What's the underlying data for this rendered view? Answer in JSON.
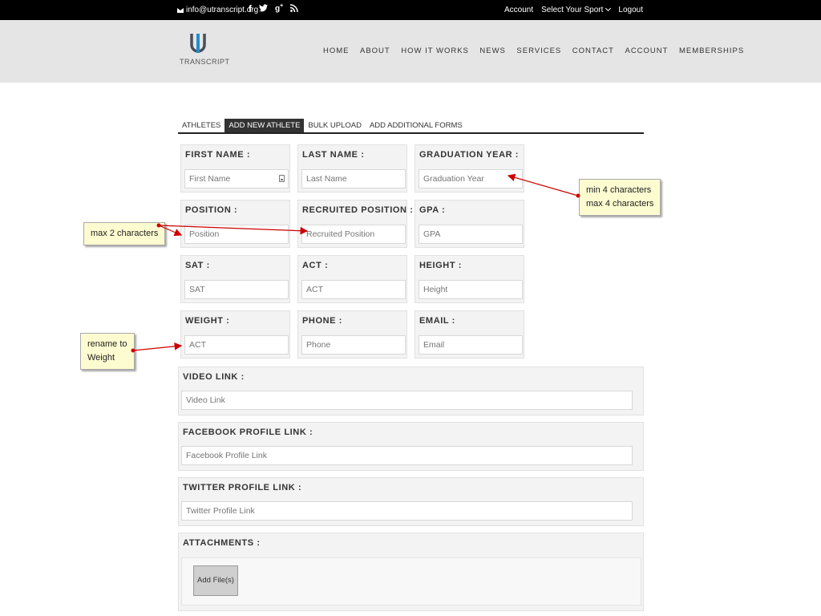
{
  "topbar": {
    "email": "info@utranscript.org",
    "social": [
      "f",
      "t",
      "g+",
      "rss"
    ],
    "account": "Account",
    "select_sport": "Select Your Sport",
    "logout": "Logout"
  },
  "logo": {
    "text": "TRANSCRIPT"
  },
  "nav": [
    "HOME",
    "ABOUT",
    "HOW IT WORKS",
    "NEWS",
    "SERVICES",
    "CONTACT",
    "ACCOUNT",
    "MEMBERSHIPS"
  ],
  "tabs": [
    "ATHLETES",
    "ADD NEW ATHLETE",
    "BULK UPLOAD",
    "ADD ADDITIONAL FORMS"
  ],
  "active_tab": "ADD NEW ATHLETE",
  "fields": {
    "first_name": {
      "label": "FIRST NAME :",
      "placeholder": "First Name"
    },
    "last_name": {
      "label": "LAST NAME :",
      "placeholder": "Last Name"
    },
    "graduation_year": {
      "label": "GRADUATION YEAR :",
      "placeholder": "Graduation Year"
    },
    "position": {
      "label": "POSITION :",
      "placeholder": "Position"
    },
    "recruited_position": {
      "label": "RECRUITED POSITION :",
      "placeholder": "Recruited Position"
    },
    "gpa": {
      "label": "GPA :",
      "placeholder": "GPA"
    },
    "sat": {
      "label": "SAT :",
      "placeholder": "SAT"
    },
    "act": {
      "label": "ACT :",
      "placeholder": "ACT"
    },
    "height": {
      "label": "HEIGHT :",
      "placeholder": "Height"
    },
    "weight": {
      "label": "WEIGHT :",
      "placeholder": "ACT"
    },
    "phone": {
      "label": "PHONE :",
      "placeholder": "Phone"
    },
    "email": {
      "label": "EMAIL :",
      "placeholder": "Email"
    },
    "video_link": {
      "label": "VIDEO LINK :",
      "placeholder": "Video Link"
    },
    "facebook": {
      "label": "FACEBOOK PROFILE LINK :",
      "placeholder": "Facebook Profile Link"
    },
    "twitter": {
      "label": "TWITTER PROFILE LINK :",
      "placeholder": "Twitter Profile Link"
    },
    "attachments": {
      "label": "ATTACHMENTS :",
      "button": "Add File(s)"
    }
  },
  "annotations": {
    "grad_year_line1": "min 4 characters",
    "grad_year_line2": "max 4 characters",
    "position": "max 2 characters",
    "weight_line1": "rename to",
    "weight_line2": "Weight"
  },
  "colors": {
    "arrow": "#cc0000",
    "note_bg": "#fdfbd0"
  }
}
